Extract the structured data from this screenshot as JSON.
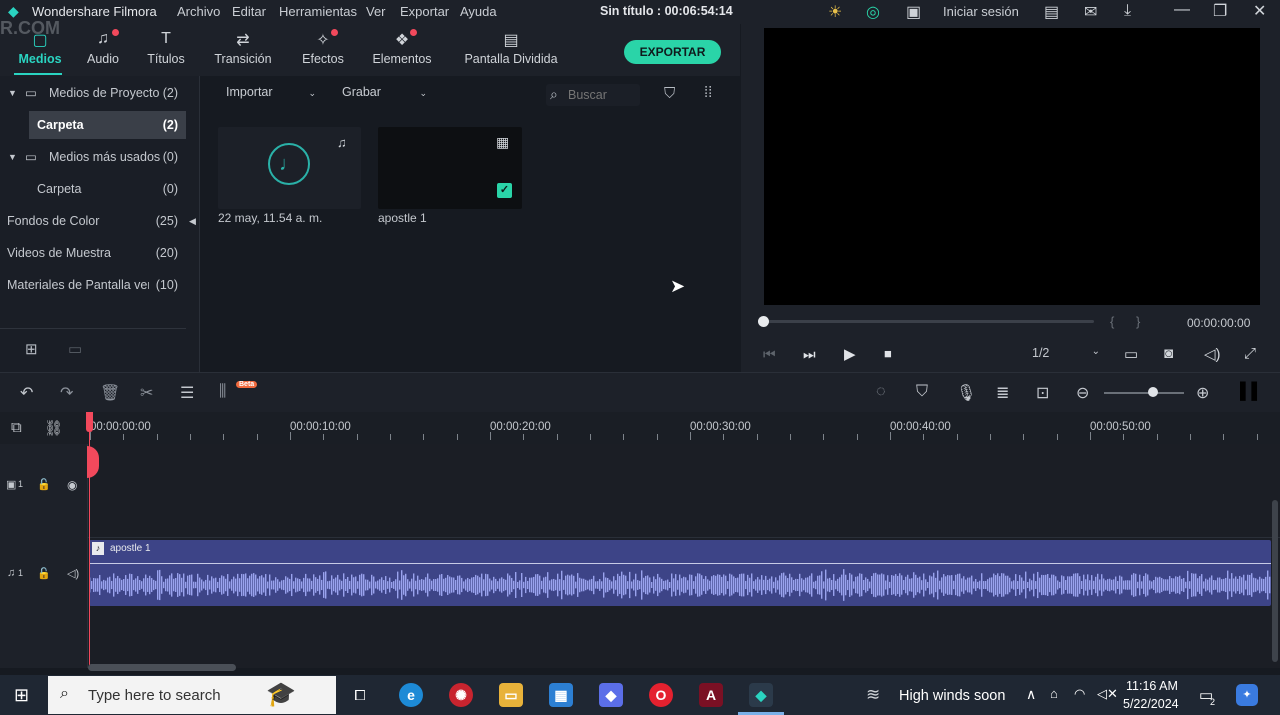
{
  "title_bar": {
    "app_name": "Wondershare Filmora",
    "menu": [
      "Archivo",
      "Editar",
      "Herramientas",
      "Ver",
      "Exportar",
      "Ayuda"
    ],
    "project_title": "Sin título : 00:06:54:14",
    "login": "Iniciar sesión"
  },
  "watermark": "R.COM",
  "tabs": [
    {
      "label": "Medios",
      "icon": "media-icon",
      "glyph": "▢"
    },
    {
      "label": "Audio",
      "icon": "music-note-icon",
      "glyph": "♫"
    },
    {
      "label": "Títulos",
      "icon": "text-icon",
      "glyph": "T"
    },
    {
      "label": "Transición",
      "icon": "transition-icon",
      "glyph": "⇄"
    },
    {
      "label": "Efectos",
      "icon": "effects-icon",
      "glyph": "✧"
    },
    {
      "label": "Elementos",
      "icon": "elements-icon",
      "glyph": "❖"
    },
    {
      "label": "Pantalla Dividida",
      "icon": "split-screen-icon",
      "glyph": "▤"
    }
  ],
  "export_label": "EXPORTAR",
  "left_panel": {
    "rows": [
      {
        "label": "Medios de Proyecto",
        "count": "(2)"
      },
      {
        "label": "Carpeta",
        "count": "(2)"
      },
      {
        "label": "Medios más usados",
        "count": "(0)"
      },
      {
        "label": "Carpeta",
        "count": "(0)"
      },
      {
        "label": "Fondos de Color",
        "count": "(25)"
      },
      {
        "label": "Videos de Muestra",
        "count": "(20)"
      },
      {
        "label": "Materiales de Pantalla verc",
        "count": "(10)"
      }
    ]
  },
  "media_toolbar": {
    "import_label": "Importar",
    "record_label": "Grabar",
    "search_placeholder": "Buscar"
  },
  "media_items": [
    {
      "name": "22 may, 11.54 a. m."
    },
    {
      "name": "apostle 1"
    }
  ],
  "preview": {
    "timecode": "00:00:00:00",
    "quality": "1/2",
    "brackets": "{      }"
  },
  "timeline": {
    "beta_badge": "Beta",
    "ruler_labels": [
      "00:00:00:00",
      "00:00:10:00",
      "00:00:20:00",
      "00:00:30:00",
      "00:00:40:00",
      "00:00:50:00"
    ],
    "track_video_label": "1",
    "track_audio_label": "1",
    "audio_clip_name": "apostle 1"
  },
  "taskbar": {
    "search_placeholder": "Type here to search",
    "weather": "High winds soon",
    "time": "11:16 AM",
    "date": "5/22/2024",
    "notification_count": "2"
  },
  "colors": {
    "accent": "#2ad4c1",
    "export_button": "#2ad4a8",
    "playhead": "#f2495c",
    "audio_clip": "#3d4487"
  }
}
